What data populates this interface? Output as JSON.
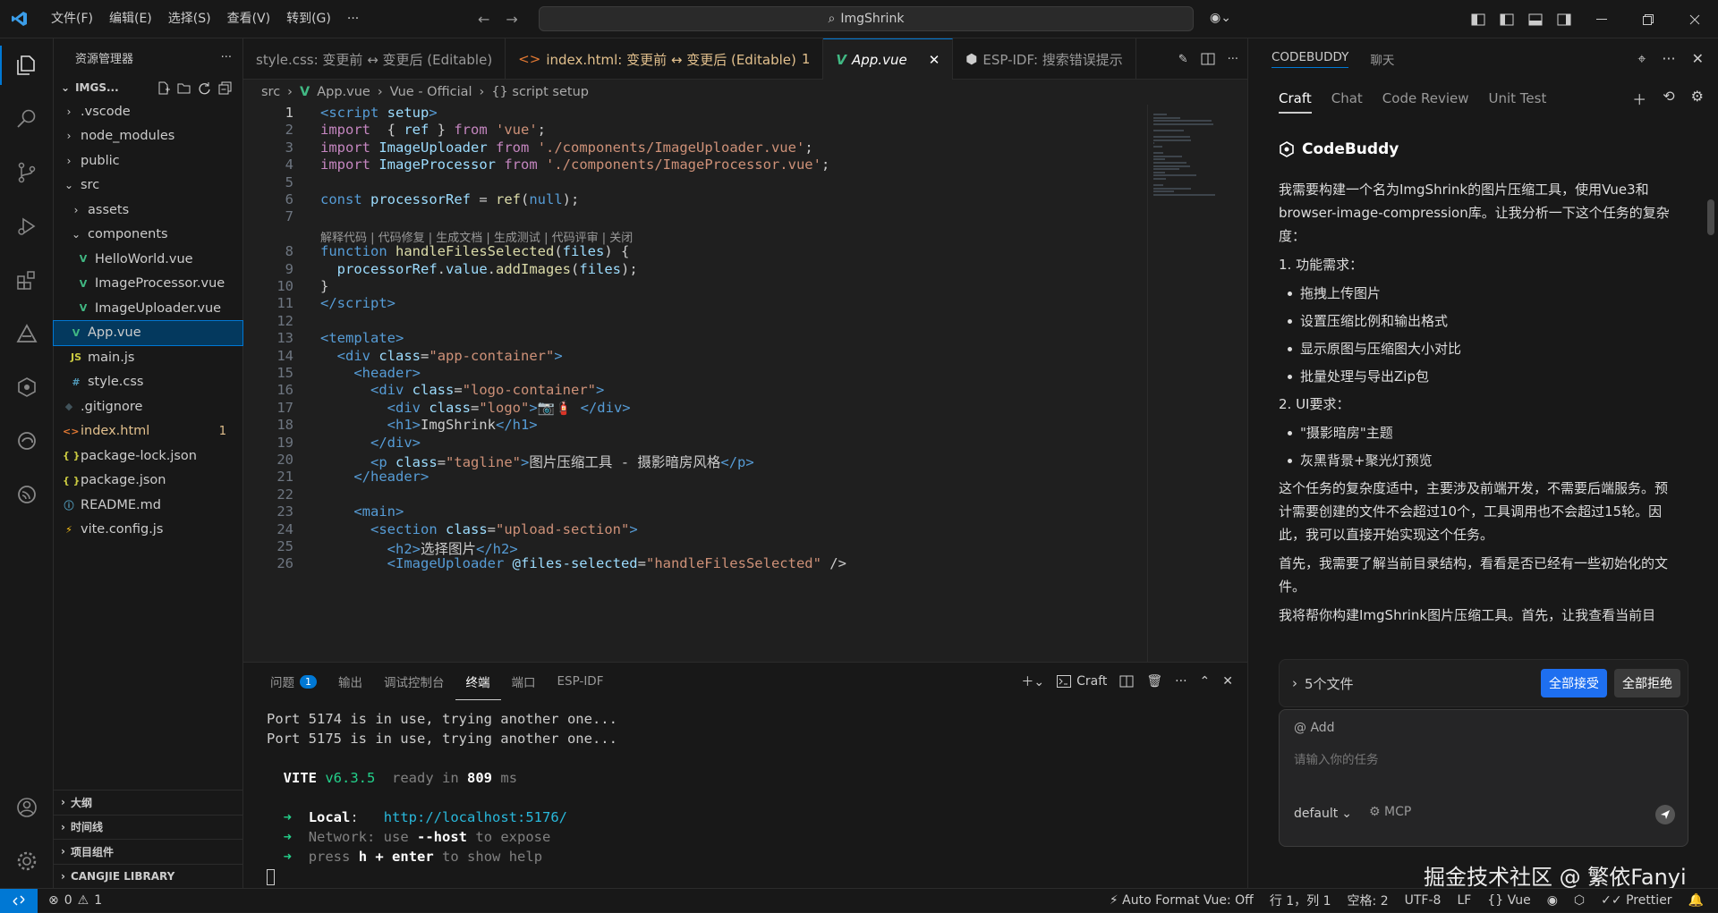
{
  "window": {
    "title": "ImgShrink"
  },
  "menu": [
    "文件(F)",
    "编辑(E)",
    "选择(S)",
    "查看(V)",
    "转到(G)",
    "···"
  ],
  "explorer": {
    "header": "资源管理器",
    "project": "IMGS...",
    "items": [
      {
        "label": ".vscode",
        "type": "folder",
        "depth": 1,
        "expanded": false
      },
      {
        "label": "node_modules",
        "type": "folder",
        "depth": 1,
        "expanded": false
      },
      {
        "label": "public",
        "type": "folder",
        "depth": 1,
        "expanded": false
      },
      {
        "label": "src",
        "type": "folder",
        "depth": 1,
        "expanded": true
      },
      {
        "label": "assets",
        "type": "folder",
        "depth": 2,
        "expanded": false
      },
      {
        "label": "components",
        "type": "folder",
        "depth": 2,
        "expanded": true
      },
      {
        "label": "HelloWorld.vue",
        "type": "vue",
        "depth": 3
      },
      {
        "label": "ImageProcessor.vue",
        "type": "vue",
        "depth": 3
      },
      {
        "label": "ImageUploader.vue",
        "type": "vue",
        "depth": 3
      },
      {
        "label": "App.vue",
        "type": "vue",
        "depth": 2,
        "selected": true
      },
      {
        "label": "main.js",
        "type": "js",
        "depth": 2
      },
      {
        "label": "style.css",
        "type": "css",
        "depth": 2
      },
      {
        "label": ".gitignore",
        "type": "git",
        "depth": 1
      },
      {
        "label": "index.html",
        "type": "html",
        "depth": 1,
        "modified": true,
        "badge": "1"
      },
      {
        "label": "package-lock.json",
        "type": "json",
        "depth": 1
      },
      {
        "label": "package.json",
        "type": "json",
        "depth": 1
      },
      {
        "label": "README.md",
        "type": "info",
        "depth": 1
      },
      {
        "label": "vite.config.js",
        "type": "vite",
        "depth": 1
      }
    ],
    "outline_sections": [
      "大纲",
      "时间线",
      "项目组件",
      "CANGJIE LIBRARY"
    ]
  },
  "tabs": [
    {
      "label": "style.css: 变更前 ↔ 变更后 (Editable)",
      "icon": "",
      "active": false,
      "modified": false
    },
    {
      "label": "index.html: 变更前 ↔ 变更后 (Editable)",
      "icon": "<>",
      "active": false,
      "modified": true,
      "badge": "1"
    },
    {
      "label": "App.vue",
      "icon": "V",
      "active": true,
      "modified": false
    },
    {
      "label": "ESP-IDF: 搜索错误提示",
      "icon": "",
      "active": false,
      "modified": false
    }
  ],
  "breadcrumb": [
    "src",
    "App.vue",
    "Vue - Official",
    "{} script setup"
  ],
  "code_lens": "解释代码 | 代码修复 | 生成文档 | 生成测试 | 代码评审 | 关闭",
  "code": [
    [
      [
        "tag",
        "<"
      ],
      [
        "tag",
        "script"
      ],
      [
        "attr",
        " setup"
      ],
      [
        "tag",
        ">"
      ]
    ],
    [
      [
        "kw2",
        "import"
      ],
      [
        "",
        "  { "
      ],
      [
        "var",
        "ref"
      ],
      [
        "",
        " } "
      ],
      [
        "kw2",
        "from"
      ],
      [
        "",
        " "
      ],
      [
        "str",
        "'vue'"
      ],
      [
        "",
        ";"
      ]
    ],
    [
      [
        "kw2",
        "import"
      ],
      [
        "",
        " "
      ],
      [
        "var",
        "ImageUploader"
      ],
      [
        "",
        " "
      ],
      [
        "kw2",
        "from"
      ],
      [
        "",
        " "
      ],
      [
        "str",
        "'./components/ImageUploader.vue'"
      ],
      [
        "",
        ";"
      ]
    ],
    [
      [
        "kw2",
        "import"
      ],
      [
        "",
        " "
      ],
      [
        "var",
        "ImageProcessor"
      ],
      [
        "",
        " "
      ],
      [
        "kw2",
        "from"
      ],
      [
        "",
        " "
      ],
      [
        "str",
        "'./components/ImageProcessor.vue'"
      ],
      [
        "",
        ";"
      ]
    ],
    [],
    [
      [
        "kw",
        "const"
      ],
      [
        "",
        " "
      ],
      [
        "var",
        "processorRef"
      ],
      [
        "",
        " = "
      ],
      [
        "fn",
        "ref"
      ],
      [
        "",
        "("
      ],
      [
        "kw",
        "null"
      ],
      [
        "",
        ");"
      ]
    ],
    [],
    [
      [
        "kw",
        "function"
      ],
      [
        "",
        " "
      ],
      [
        "fn",
        "handleFilesSelected"
      ],
      [
        "",
        "("
      ],
      [
        "var",
        "files"
      ],
      [
        "",
        ") {"
      ]
    ],
    [
      [
        "",
        "  "
      ],
      [
        "var",
        "processorRef"
      ],
      [
        "",
        "."
      ],
      [
        "var",
        "value"
      ],
      [
        "",
        "."
      ],
      [
        "fn",
        "addImages"
      ],
      [
        "",
        "("
      ],
      [
        "var",
        "files"
      ],
      [
        "",
        ");"
      ]
    ],
    [
      [
        "",
        "}"
      ]
    ],
    [
      [
        "tag",
        "</"
      ],
      [
        "tag",
        "script"
      ],
      [
        "tag",
        ">"
      ]
    ],
    [],
    [
      [
        "tag",
        "<"
      ],
      [
        "tag",
        "template"
      ],
      [
        "tag",
        ">"
      ]
    ],
    [
      [
        "",
        "  "
      ],
      [
        "tag",
        "<div"
      ],
      [
        "",
        " "
      ],
      [
        "attr",
        "class"
      ],
      [
        "",
        "="
      ],
      [
        "str",
        "\"app-container\""
      ],
      [
        "tag",
        ">"
      ]
    ],
    [
      [
        "",
        "    "
      ],
      [
        "tag",
        "<header>"
      ]
    ],
    [
      [
        "",
        "      "
      ],
      [
        "tag",
        "<div"
      ],
      [
        "",
        " "
      ],
      [
        "attr",
        "class"
      ],
      [
        "",
        "="
      ],
      [
        "str",
        "\"logo-container\""
      ],
      [
        "tag",
        ">"
      ]
    ],
    [
      [
        "",
        "        "
      ],
      [
        "tag",
        "<div"
      ],
      [
        "",
        " "
      ],
      [
        "attr",
        "class"
      ],
      [
        "",
        "="
      ],
      [
        "str",
        "\"logo\""
      ],
      [
        "tag",
        ">"
      ],
      [
        "",
        "📷🧯 "
      ],
      [
        "tag",
        "</div>"
      ]
    ],
    [
      [
        "",
        "        "
      ],
      [
        "tag",
        "<h1>"
      ],
      [
        "",
        "ImgShrink"
      ],
      [
        "tag",
        "</h1>"
      ]
    ],
    [
      [
        "",
        "      "
      ],
      [
        "tag",
        "</div>"
      ]
    ],
    [
      [
        "",
        "      "
      ],
      [
        "tag",
        "<p"
      ],
      [
        "",
        " "
      ],
      [
        "attr",
        "class"
      ],
      [
        "",
        "="
      ],
      [
        "str",
        "\"tagline\""
      ],
      [
        "tag",
        ">"
      ],
      [
        "",
        "图片压缩工具 - 摄影暗房风格"
      ],
      [
        "tag",
        "</p>"
      ]
    ],
    [
      [
        "",
        "    "
      ],
      [
        "tag",
        "</header>"
      ]
    ],
    [],
    [
      [
        "",
        "    "
      ],
      [
        "tag",
        "<main>"
      ]
    ],
    [
      [
        "",
        "      "
      ],
      [
        "tag",
        "<section"
      ],
      [
        "",
        " "
      ],
      [
        "attr",
        "class"
      ],
      [
        "",
        "="
      ],
      [
        "str",
        "\"upload-section\""
      ],
      [
        "tag",
        ">"
      ]
    ],
    [
      [
        "",
        "        "
      ],
      [
        "tag",
        "<h2>"
      ],
      [
        "",
        "选择图片"
      ],
      [
        "tag",
        "</h2>"
      ]
    ],
    [
      [
        "",
        "        "
      ],
      [
        "tag",
        "<ImageUploader"
      ],
      [
        "",
        " "
      ],
      [
        "attr",
        "@files-selected"
      ],
      [
        "",
        "="
      ],
      [
        "str",
        "\"handleFilesSelected\""
      ],
      [
        "",
        " />"
      ]
    ]
  ],
  "panel": {
    "tabs": [
      "问题",
      "输出",
      "调试控制台",
      "终端",
      "端口",
      "ESP-IDF"
    ],
    "problems_count": "1",
    "active_tab": "终端",
    "craft_label": "Craft",
    "terminal_lines": [
      "Port 5174 is in use, trying another one...",
      "Port 5175 is in use, trying another one...",
      "",
      "  VITE v6.3.5  ready in 809 ms",
      "",
      "  ➜  Local:   http://localhost:5176/",
      "  ➜  Network: use --host to expose",
      "  ➜  press h + enter to show help"
    ],
    "vite_version": "v6.3.5",
    "ready_ms": "809",
    "local_url": "http://localhost:5176/"
  },
  "codebuddy": {
    "header_tabs": [
      "CODEBUDDY",
      "聊天"
    ],
    "tabs": [
      "Craft",
      "Chat",
      "Code Review",
      "Unit Test"
    ],
    "brand": "CodeBuddy",
    "messages": [
      {
        "kind": "p",
        "text": "我需要构建一个名为ImgShrink的图片压缩工具，使用Vue3和browser-image-compression库。让我分析一下这个任务的复杂度："
      },
      {
        "kind": "p",
        "text": "1. 功能需求："
      },
      {
        "kind": "li",
        "text": "拖拽上传图片"
      },
      {
        "kind": "li",
        "text": "设置压缩比例和输出格式"
      },
      {
        "kind": "li",
        "text": "显示原图与压缩图大小对比"
      },
      {
        "kind": "li",
        "text": "批量处理与导出Zip包"
      },
      {
        "kind": "p",
        "text": "2. UI要求："
      },
      {
        "kind": "li",
        "text": "\"摄影暗房\"主题"
      },
      {
        "kind": "li",
        "text": "灰黑背景+聚光灯预览"
      },
      {
        "kind": "p",
        "text": "这个任务的复杂度适中，主要涉及前端开发，不需要后端服务。预计需要创建的文件不会超过10个，工具调用也不会超过15轮。因此，我可以直接开始实现这个任务。"
      },
      {
        "kind": "p",
        "text": "首先，我需要了解当前目录结构，看看是否已经有一些初始化的文件。"
      },
      {
        "kind": "p",
        "text": "我将帮你构建ImgShrink图片压缩工具。首先，让我查看当前目"
      }
    ],
    "pending_files": "5个文件",
    "accept_all": "全部接受",
    "reject_all": "全部拒绝",
    "add_label": "@ Add",
    "input_placeholder": "请输入你的任务",
    "mode": "default",
    "mcp": "MCP"
  },
  "watermark": "掘金技术社区 @ 繁依Fanyi",
  "status": {
    "errors": "0",
    "warnings": "1",
    "auto_format": "Auto Format Vue: Off",
    "position": "行 1，列 1",
    "spaces": "空格: 2",
    "encoding": "UTF-8",
    "eol": "LF",
    "language": "Vue",
    "prettier": "Prettier"
  }
}
